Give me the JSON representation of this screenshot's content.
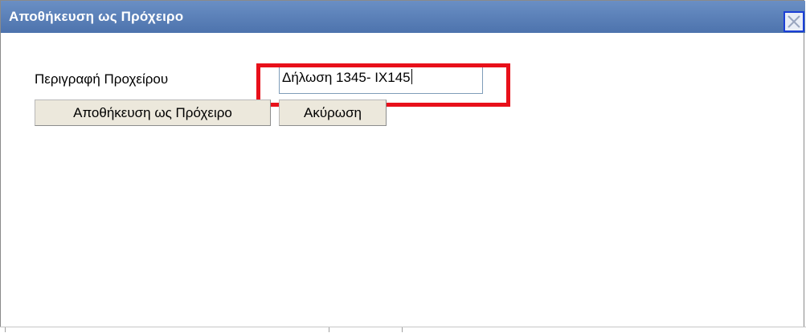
{
  "dialog": {
    "title": "Αποθήκευση ως Πρόχειρο",
    "close_icon": "close-icon"
  },
  "form": {
    "description_label": "Περιγραφή Προχείρου",
    "description_value": "Δήλωση 1345- ΙΧ145"
  },
  "buttons": {
    "save_label": "Αποθήκευση ως Πρόχειρο",
    "cancel_label": "Ακύρωση"
  },
  "annotation": {
    "highlight_color": "#e8101a"
  },
  "colors": {
    "titlebar": "#5a80ba",
    "button_bg": "#ece8dc"
  }
}
